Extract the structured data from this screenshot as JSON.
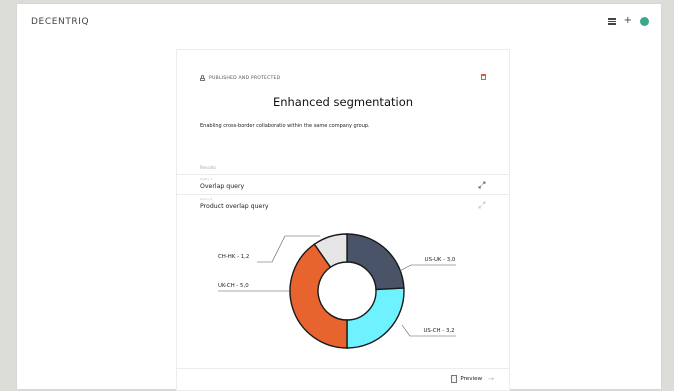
{
  "app": {
    "brand": "DECENTRIQ"
  },
  "card": {
    "status": "PUBLISHED AND PROTECTED",
    "title": "Enhanced segmentation",
    "description": "Enabling cross-border collaboratio within the same company group.",
    "results_label": "Results",
    "queries": [
      {
        "meta": "Query 1",
        "name": "Overlap query"
      },
      {
        "meta": "Query 2",
        "name": "Product overlap query"
      }
    ],
    "preview_label": "Preview"
  },
  "chart_data": {
    "type": "pie",
    "variant": "donut",
    "segments": [
      {
        "label": "US-UK - 3,0",
        "value": 3.0,
        "color": "#4a5468"
      },
      {
        "label": "US-CH - 3,2",
        "value": 3.2,
        "color": "#6ff2ff"
      },
      {
        "label": "UK-CH - 5,0",
        "value": 5.0,
        "color": "#e8642e"
      },
      {
        "label": "CH-HK - 1,2",
        "value": 1.2,
        "color": "#e6e6e6"
      }
    ]
  },
  "colors": {
    "accent": "#e05a3a",
    "avatar": "#3aa88a"
  },
  "icons": [
    "grid-icon",
    "plus-icon",
    "avatar",
    "lock-icon",
    "trash-icon",
    "expand-icon",
    "document-icon",
    "arrow-right-icon"
  ]
}
